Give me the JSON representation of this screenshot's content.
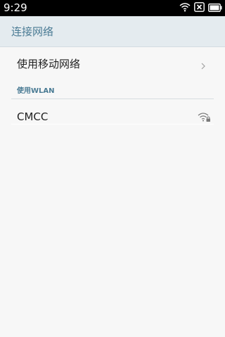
{
  "status_bar": {
    "time": "9:29",
    "icons": [
      "wifi-icon",
      "no-signal-icon",
      "battery-icon"
    ]
  },
  "header": {
    "title": "连接网络"
  },
  "mobile_network": {
    "label": "使用移动网络",
    "chevron": "chevron-right-icon"
  },
  "wlan_section": {
    "header": "使用WLAN",
    "networks": [
      {
        "ssid": "CMCC",
        "icon": "wifi-lock-icon",
        "secured": true
      }
    ]
  },
  "colors": {
    "accent": "#4a7b94",
    "header_bg": "#e4ebef",
    "background": "#f7f7f7"
  }
}
